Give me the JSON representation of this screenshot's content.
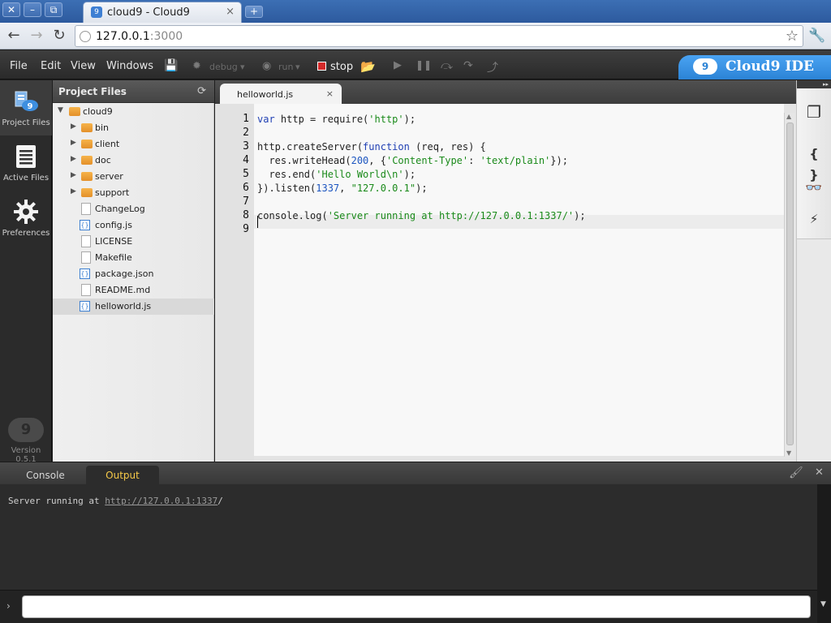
{
  "browser": {
    "tab_title": "cloud9 - Cloud9",
    "tab_favicon_glyph": "9",
    "tab_close": "×",
    "new_tab": "+",
    "url_host": "127.0.0.1",
    "url_port": ":3000",
    "window_buttons": {
      "close": "✕",
      "minimize": "–",
      "maximize": "⧉"
    },
    "nav": {
      "back": "←",
      "forward": "→",
      "reload": "↻",
      "star": "☆",
      "wrench": "🔧"
    }
  },
  "menubar": {
    "items": [
      "File",
      "Edit",
      "View",
      "Windows"
    ],
    "save_icon": "💾",
    "debug_label": "debug",
    "run_label": "run",
    "stop_label": "stop",
    "caret": "▾",
    "controls": {
      "resume": "▶",
      "pause": "❚❚",
      "step_over": "⤼",
      "step_into": "↷",
      "step_out": "⤴"
    },
    "brand_glyph": "9",
    "brand": "Cloud9 IDE"
  },
  "dock": {
    "items": [
      {
        "label": "Project Files",
        "icon": "project-files-icon"
      },
      {
        "label": "Active Files",
        "icon": "active-files-icon"
      },
      {
        "label": "Preferences",
        "icon": "gear-icon"
      }
    ],
    "version_glyph": "9",
    "version": "Version 0.5.1"
  },
  "project_files": {
    "title": "Project Files",
    "refresh_glyph": "⟳",
    "root": "cloud9",
    "expand_glyph": "▼",
    "collapsed_glyph": "▶",
    "js_glyph": "{}",
    "folders": [
      "bin",
      "client",
      "doc",
      "server",
      "support"
    ],
    "files": [
      {
        "name": "ChangeLog",
        "type": "text"
      },
      {
        "name": "config.js",
        "type": "js"
      },
      {
        "name": "LICENSE",
        "type": "text"
      },
      {
        "name": "Makefile",
        "type": "text"
      },
      {
        "name": "package.json",
        "type": "js"
      },
      {
        "name": "README.md",
        "type": "text"
      },
      {
        "name": "helloworld.js",
        "type": "js",
        "selected": true
      }
    ]
  },
  "editor": {
    "tab_label": "helloworld.js",
    "tab_close": "×",
    "line_numbers": [
      "1",
      "2",
      "3",
      "4",
      "5",
      "6",
      "7",
      "8",
      "9"
    ],
    "scroll_up": "▲",
    "scroll_down": "▼",
    "code": {
      "l1": {
        "a": "var",
        "b": " http = require(",
        "c": "'http'",
        "d": ");"
      },
      "l3": {
        "a": "http.createServer(",
        "b": "function",
        "c": " (req, res) {"
      },
      "l4": {
        "a": "  res.writeHead(",
        "b": "200",
        "c": ", {",
        "d": "'Content-Type'",
        "e": ": ",
        "f": "'text/plain'",
        "g": "});"
      },
      "l5": {
        "a": "  res.end(",
        "b": "'Hello World\\n'",
        "c": ");"
      },
      "l6": {
        "a": "}).listen(",
        "b": "1337",
        "c": ", ",
        "d": "\"127.0.0.1\"",
        "e": ");"
      },
      "l8": {
        "a": "console.log(",
        "b": "'Server running at http://127.0.0.1:1337/'",
        "c": ");"
      }
    }
  },
  "right_dock": {
    "collapse_glyph": "▸▸",
    "icons": [
      {
        "name": "windows-icon",
        "glyph": "❐"
      },
      {
        "name": "outline-icon",
        "glyph": "{ }"
      },
      {
        "name": "zen-mode-icon",
        "glyph": "👓"
      },
      {
        "name": "deploy-icon",
        "glyph": "⚡"
      }
    ]
  },
  "console": {
    "tabs": [
      "Console",
      "Output"
    ],
    "active_tab": "Output",
    "clear_glyph": "🖌",
    "close_glyph": "✕",
    "output_prefix": "Server running at ",
    "output_link": "http://127.0.0.1:1337",
    "output_suffix": "/",
    "prompt_glyph": "›",
    "scroll_down": "▼",
    "command_value": ""
  },
  "colors": {
    "accent": "#2b83d6",
    "keyword": "#1f3fb3",
    "string": "#1a8a1a",
    "number": "#1d56c0",
    "output_tab": "#f6c948",
    "stop": "#d42a2a"
  }
}
